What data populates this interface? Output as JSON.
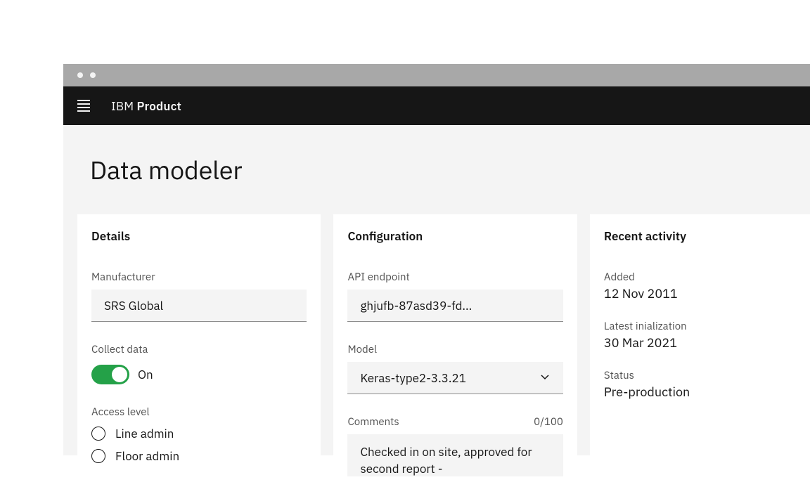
{
  "header": {
    "brand_light": "IBM",
    "brand_bold": "Product"
  },
  "page": {
    "title": "Data modeler"
  },
  "details": {
    "title": "Details",
    "manufacturer_label": "Manufacturer",
    "manufacturer_value": "SRS Global",
    "collect_data_label": "Collect data",
    "collect_data_state": "On",
    "access_level_label": "Access level",
    "access_options": {
      "0": "Line admin",
      "1": "Floor admin"
    }
  },
  "config": {
    "title": "Configuration",
    "api_label": "API endpoint",
    "api_value": "ghjufb-87asd39-fd...",
    "model_label": "Model",
    "model_value": "Keras-type2-3.3.21",
    "comments_label": "Comments",
    "comments_counter": "0/100",
    "comments_value": "Checked in on site, approved for second report -"
  },
  "activity": {
    "title": "Recent activity",
    "added_label": "Added",
    "added_value": "12 Nov 2011",
    "init_label": "Latest inialization",
    "init_value": "30 Mar 2021",
    "status_label": "Status",
    "status_value": "Pre-production"
  }
}
